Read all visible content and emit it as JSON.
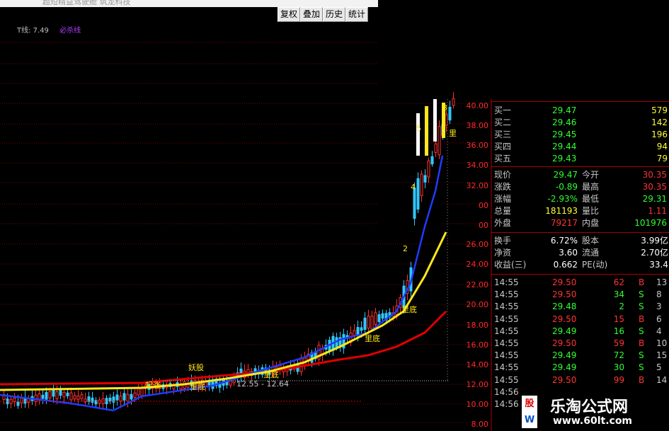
{
  "window": {
    "title": "超短精益驾驶舱 筑龙科技"
  },
  "toolbar": {
    "buttons": [
      "复权",
      "叠加",
      "历史",
      "统计"
    ]
  },
  "indicator": {
    "value_text": "T线: 7.49",
    "name": "必杀线"
  },
  "chart": {
    "y_axis_labels_top": [
      "40.00",
      "38.00",
      "36.00",
      "34.00",
      "32.00",
      "00",
      "00"
    ],
    "y_axis_labels_bottom": [
      "26.00",
      "24.00",
      "22.00",
      "20.00",
      "18.00",
      "16.00",
      "14.00",
      "12.00",
      "10.00",
      "8.00"
    ],
    "range_label": "12.55 - 12.64",
    "tags": [
      "妖股",
      "起涨",
      "里底",
      "里底",
      "里底",
      "里底",
      "里"
    ],
    "digit_marks": [
      "8",
      "5",
      "4",
      "2"
    ],
    "colors": {
      "ma_yellow": "#ffe81a",
      "ma_blue": "#1e3cff",
      "ma_red": "#e00000",
      "candle_up": "#ff3030",
      "candle_down": "#30c8ff"
    }
  },
  "quote": {
    "bids": [
      {
        "label": "买一",
        "price": "29.47",
        "vol": "579"
      },
      {
        "label": "买二",
        "price": "29.46",
        "vol": "142"
      },
      {
        "label": "买三",
        "price": "29.45",
        "vol": "196"
      },
      {
        "label": "买四",
        "price": "29.44",
        "vol": "94"
      },
      {
        "label": "买五",
        "price": "29.43",
        "vol": "79"
      }
    ],
    "stats": [
      {
        "l1": "现价",
        "v1": "29.47",
        "l2": "今开",
        "v2": "30.35"
      },
      {
        "l1": "涨跌",
        "v1": "-0.89",
        "l2": "最高",
        "v2": "30.35"
      },
      {
        "l1": "涨幅",
        "v1": "-2.93%",
        "l2": "最低",
        "v2": "29.31"
      },
      {
        "l1": "总量",
        "v1": "181193",
        "l2": "量比",
        "v2": "1.11"
      },
      {
        "l1": "外盘",
        "v1": "79217",
        "l2": "内盘",
        "v2": "101976"
      }
    ],
    "fundamentals": [
      {
        "l1": "换手",
        "v1": "6.72%",
        "l2": "股本",
        "v2": "3.99亿"
      },
      {
        "l1": "净资",
        "v1": "3.60",
        "l2": "流通",
        "v2": "2.70亿"
      },
      {
        "l1": "收益(三)",
        "v1": "0.662",
        "l2": "PE(动)",
        "v2": "33.4"
      }
    ],
    "ticks": [
      {
        "time": "14:55",
        "price": "29.50",
        "vol": "62",
        "side": "B",
        "n": "13"
      },
      {
        "time": "14:55",
        "price": "29.50",
        "vol": "34",
        "side": "S",
        "n": "8"
      },
      {
        "time": "14:55",
        "price": "29.48",
        "vol": "2",
        "side": "S",
        "n": "3"
      },
      {
        "time": "14:55",
        "price": "29.50",
        "vol": "15",
        "side": "B",
        "n": "6"
      },
      {
        "time": "14:55",
        "price": "29.49",
        "vol": "16",
        "side": "S",
        "n": "4"
      },
      {
        "time": "14:55",
        "price": "29.50",
        "vol": "59",
        "side": "B",
        "n": "10"
      },
      {
        "time": "14:55",
        "price": "29.49",
        "vol": "72",
        "side": "S",
        "n": "15"
      },
      {
        "time": "14:55",
        "price": "29.49",
        "vol": "30",
        "side": "S",
        "n": "5"
      },
      {
        "time": "14:55",
        "price": "29.50",
        "vol": "99",
        "side": "B",
        "n": "14"
      },
      {
        "time": "14:56",
        "price": "",
        "vol": "",
        "side": "",
        "n": ""
      },
      {
        "time": "14:56",
        "price": "",
        "vol": "",
        "side": "",
        "n": ""
      }
    ]
  },
  "watermark": {
    "logo_top": "股",
    "logo_bottom": "W",
    "brand": "乐淘公式网",
    "url": "www.60lt.com"
  }
}
